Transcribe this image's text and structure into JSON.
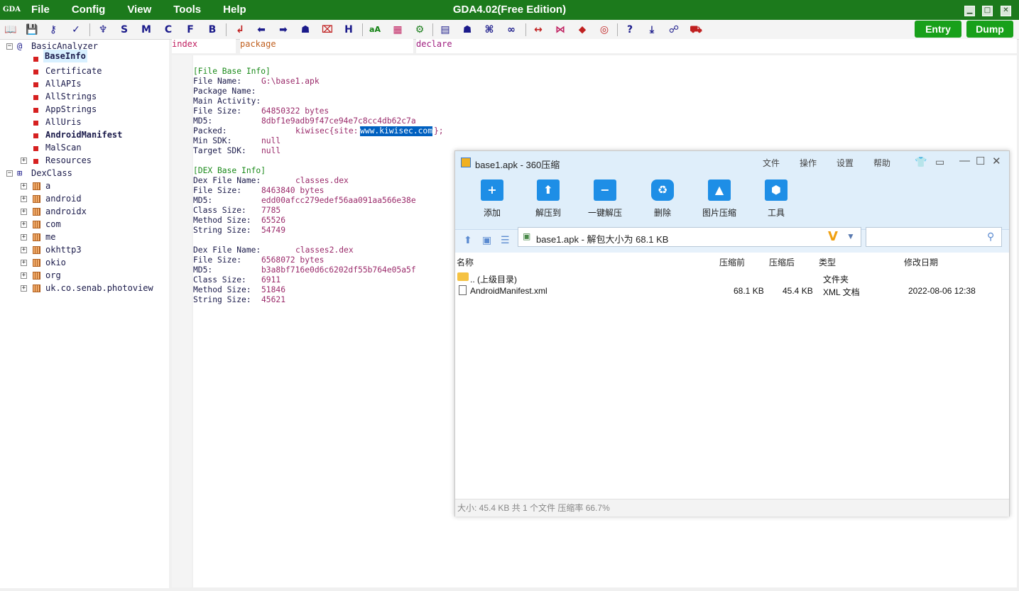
{
  "app": {
    "title": "GDA4.02(Free Edition)",
    "menu": [
      "File",
      "Config",
      "View",
      "Tools",
      "Help"
    ],
    "entry_button": "Entry",
    "dump_button": "Dump",
    "logo_text": "GDA"
  },
  "toolbar": {
    "letters": [
      "S",
      "M",
      "C",
      "F",
      "B",
      "H",
      "?"
    ]
  },
  "tree": {
    "root1": "BasicAnalyzer",
    "analyzer_items": [
      "BaseInfo",
      "Certificate",
      "AllAPIs",
      "AllStrings",
      "AppStrings",
      "AllUris",
      "AndroidManifest",
      "MalScan",
      "Resources"
    ],
    "root2": "DexClass",
    "packages": [
      "a",
      "android",
      "androidx",
      "com",
      "me",
      "okhttp3",
      "okio",
      "org",
      "uk.co.senab.photoview"
    ]
  },
  "columns": {
    "index": "index",
    "package": "package",
    "declare": "declare"
  },
  "code": {
    "file_base_header": "[File Base Info]",
    "file_name_label": "File Name:",
    "file_name": "G:\\base1.apk",
    "package_name_label": "Package Name:",
    "main_activity_label": "Main Activity:",
    "file_size_label": "File Size:",
    "file_size": "64850322 bytes",
    "md5_label": "MD5:",
    "md5": "8dbf1e9adb9f47ce94e7c8cc4db62c7a",
    "packed_label": "Packed:",
    "packed_prefix": "kiwisec{site:",
    "packed_site": "www.kiwisec.com",
    "packed_suffix": "};",
    "min_sdk_label": "Min SDK:",
    "min_sdk": "null",
    "target_sdk_label": "Target SDK:",
    "target_sdk": "null",
    "dex_base_header": "[DEX Base Info]",
    "dex_file_name_label": "Dex File Name:",
    "class_size_label": "Class Size:",
    "method_size_label": "Method Size:",
    "string_size_label": "String Size:",
    "dex1": {
      "name": "classes.dex",
      "size": "8463840 bytes",
      "md5": "edd00afcc279edef56aa091aa566e38e",
      "class_size": "7785",
      "method_size": "65526",
      "string_size": "54749"
    },
    "dex2": {
      "name": "classes2.dex",
      "size": "6568072 bytes",
      "md5": "b3a8bf716e0d6c6202df55b764e05a5f",
      "class_size": "6911",
      "method_size": "51846",
      "string_size": "45621"
    }
  },
  "zip": {
    "title": "base1.apk - 360压缩",
    "menu": [
      "文件",
      "操作",
      "设置",
      "帮助"
    ],
    "actions": [
      "添加",
      "解压到",
      "一键解压",
      "删除",
      "图片压缩",
      "工具"
    ],
    "path": "base1.apk - 解包大小为 68.1 KB",
    "columns": [
      "名称",
      "压缩前",
      "压缩后",
      "类型",
      "修改日期"
    ],
    "rows": [
      {
        "name": ".. (上级目录)",
        "before": "",
        "after": "",
        "type": "文件夹",
        "date": ""
      },
      {
        "name": "AndroidManifest.xml",
        "before": "68.1 KB",
        "after": "45.4 KB",
        "type": "XML 文档",
        "date": "2022-08-06 12:38"
      }
    ],
    "status": "大小: 45.4 KB 共 1 个文件 压缩率 66.7%"
  }
}
